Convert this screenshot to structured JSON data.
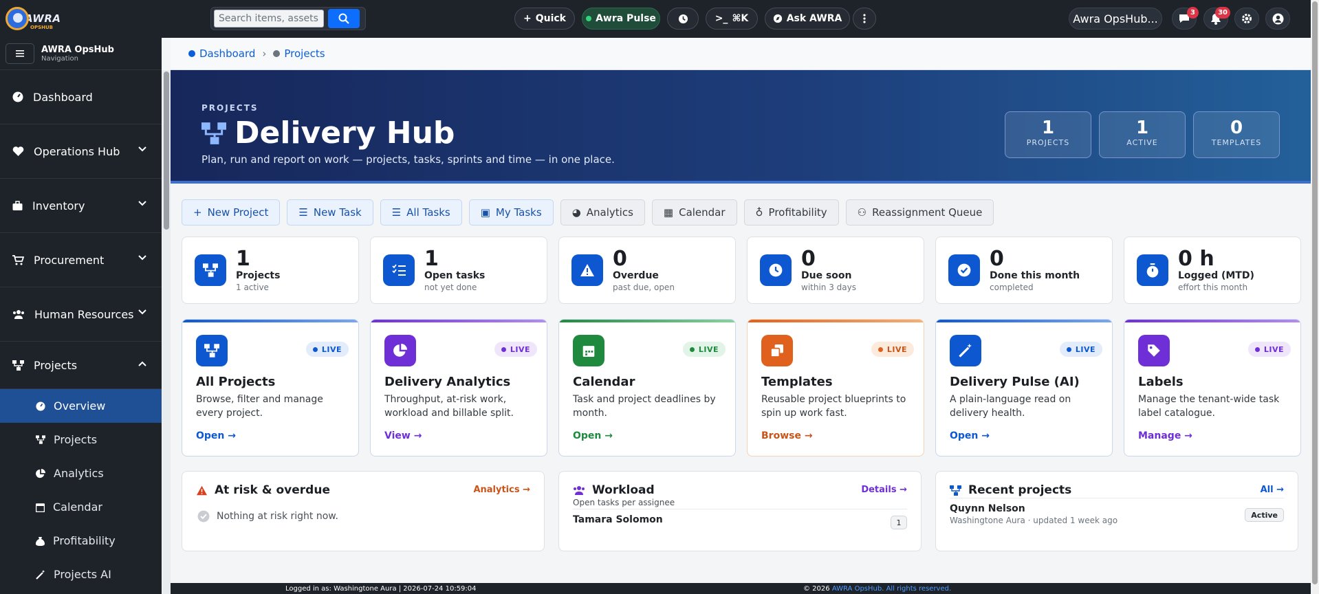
{
  "brand": {
    "logo_text": "AWRA",
    "logo_sub": "OPSHUB"
  },
  "topbar": {
    "search_placeholder": "Search items, assets,",
    "quick_label": "Quick",
    "pulse_label": "Awra Pulse",
    "cmd_label": "⌘K",
    "ask_label": "Ask AWRA",
    "user_label": "Awra OpsHub...",
    "messages_badge": "3",
    "notifications_badge": "30"
  },
  "sidebar": {
    "title": "AWRA OpsHub",
    "subtitle": "Navigation",
    "items": [
      {
        "label": "Dashboard"
      },
      {
        "label": "Operations Hub"
      },
      {
        "label": "Inventory"
      },
      {
        "label": "Procurement"
      },
      {
        "label": "Human Resources"
      },
      {
        "label": "Projects"
      }
    ],
    "subitems": [
      {
        "label": "Overview"
      },
      {
        "label": "Projects"
      },
      {
        "label": "Analytics"
      },
      {
        "label": "Calendar"
      },
      {
        "label": "Profitability"
      },
      {
        "label": "Projects AI"
      }
    ]
  },
  "breadcrumb": {
    "items": [
      "Dashboard",
      "Projects"
    ],
    "separator": "›"
  },
  "hero": {
    "kicker": "PROJECTS",
    "title": "Delivery Hub",
    "subtitle": "Plan, run and report on work — projects, tasks, sprints and time — in one place.",
    "stats": [
      {
        "value": "1",
        "label": "PROJECTS"
      },
      {
        "value": "1",
        "label": "ACTIVE"
      },
      {
        "value": "0",
        "label": "TEMPLATES"
      }
    ]
  },
  "actions": [
    "New Project",
    "New Task",
    "All Tasks",
    "My Tasks",
    "Analytics",
    "Calendar",
    "Profitability",
    "Reassignment Queue"
  ],
  "stats": [
    {
      "value": "1",
      "label": "Projects",
      "sub": "1 active"
    },
    {
      "value": "1",
      "label": "Open tasks",
      "sub": "not yet done"
    },
    {
      "value": "0",
      "label": "Overdue",
      "sub": "past due, open"
    },
    {
      "value": "0",
      "label": "Due soon",
      "sub": "within 3 days"
    },
    {
      "value": "0",
      "label": "Done this month",
      "sub": "completed"
    },
    {
      "value": "0 h",
      "label": "Logged (MTD)",
      "sub": "effort this month"
    }
  ],
  "features": [
    {
      "title": "All Projects",
      "desc": "Browse, filter and manage every project.",
      "link": "Open →",
      "badge": "LIVE"
    },
    {
      "title": "Delivery Analytics",
      "desc": "Throughput, at-risk work, workload and billable split.",
      "link": "View →",
      "badge": "LIVE"
    },
    {
      "title": "Calendar",
      "desc": "Task and project deadlines by month.",
      "link": "Open →",
      "badge": "LIVE"
    },
    {
      "title": "Templates",
      "desc": "Reusable project blueprints to spin up work fast.",
      "link": "Browse →",
      "badge": "LIVE"
    },
    {
      "title": "Delivery Pulse (AI)",
      "desc": "A plain-language read on delivery health.",
      "link": "Open →",
      "badge": "LIVE"
    },
    {
      "title": "Labels",
      "desc": "Manage the tenant-wide task label catalogue.",
      "link": "Manage →",
      "badge": "LIVE"
    }
  ],
  "panels": {
    "risk": {
      "title": "At risk & overdue",
      "link": "Analytics →",
      "empty": "Nothing at risk right now."
    },
    "workload": {
      "title": "Workload",
      "link": "Details →",
      "subtitle": "Open tasks per assignee",
      "rows": [
        {
          "name": "Tamara Solomon",
          "count": "1"
        }
      ]
    },
    "recent": {
      "title": "Recent projects",
      "link": "All →",
      "rows": [
        {
          "name": "Quynn Nelson",
          "meta": "Washingtone Aura · updated 1 week ago",
          "status": "Active"
        }
      ]
    }
  },
  "footer": {
    "left": "Logged in as: Washingtone Aura | 2026-07-24 10:59:04",
    "copyright": "© 2026",
    "brand": "AWRA OpsHub",
    "rights": ". All rights reserved."
  },
  "colors": {
    "primary": "#0d58d1",
    "purple": "#6f2fd6",
    "green": "#1f8a3e",
    "orange": "#e0611d",
    "brand_blue": "#1f4f94"
  }
}
